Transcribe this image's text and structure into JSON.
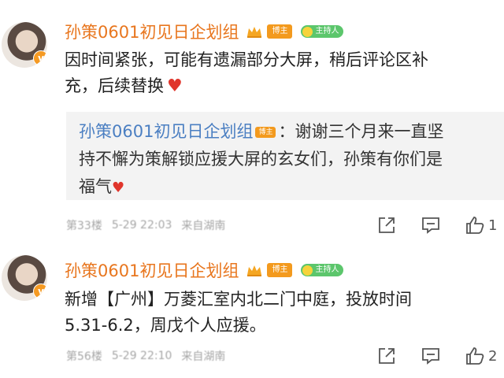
{
  "comments": [
    {
      "username": "孙策0601初见日企划组",
      "badge_owner": "博主",
      "badge_host": "主持人",
      "text_lines": [
        "因时间紧张，可能有遗漏部分大屏，稍后评论区补",
        "充，后续替换"
      ],
      "reply": {
        "username": "孙策0601初见日企划组",
        "badge": "博主",
        "separator": "：",
        "lines": [
          "谢谢三个月来一直坚",
          "持不懈为策解锁应援大屏的玄女们，孙策有你们是",
          "福气"
        ]
      },
      "meta": {
        "floor": "第33楼",
        "time": "5-29 22:03",
        "source": "来自湖南"
      },
      "likes": "1"
    },
    {
      "username": "孙策0601初见日企划组",
      "badge_owner": "博主",
      "badge_host": "主持人",
      "text_lines": [
        "新增【广州】万菱汇室内北二门中庭，投放时间",
        "5.31-6.2，周戊个人应援。"
      ],
      "meta": {
        "floor": "第56楼",
        "time": "5-29 22:10",
        "source": "来自湖南"
      },
      "likes": "2"
    }
  ],
  "colors": {
    "username": "#e8761e",
    "reply_username": "#4b7fc2",
    "heart": "#e0352b",
    "host_badge": "#5cc66c"
  },
  "icons": [
    "verified-v-icon",
    "crown-icon",
    "heart-icon",
    "share-icon",
    "comment-icon",
    "like-icon"
  ]
}
